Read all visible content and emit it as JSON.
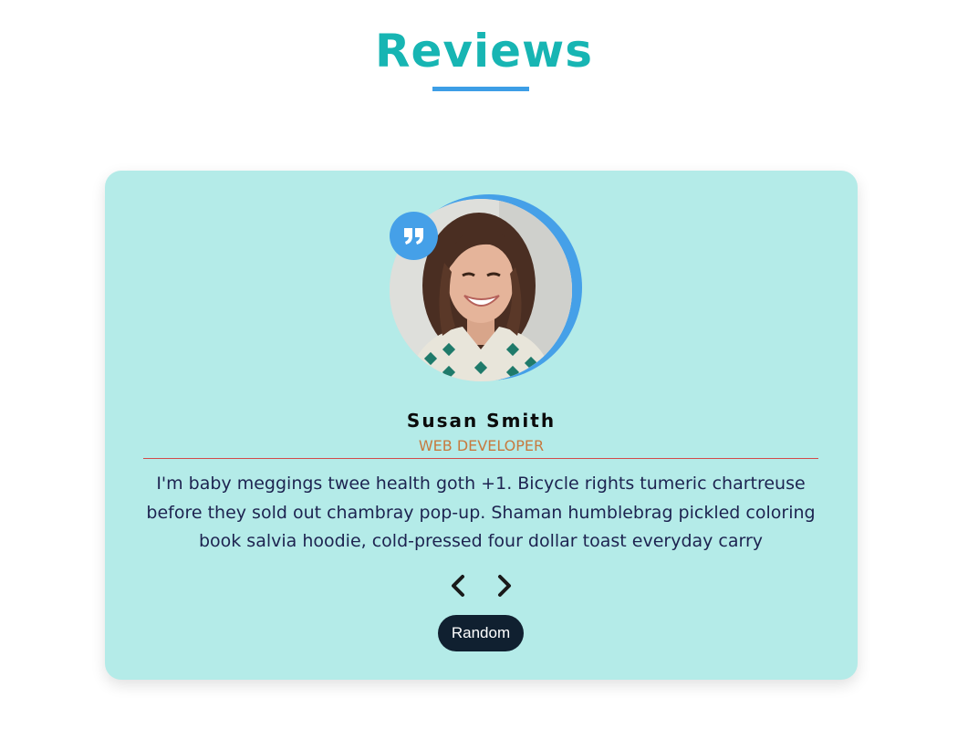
{
  "header": {
    "title": "Reviews"
  },
  "review": {
    "name": "Susan Smith",
    "job": "web developer",
    "text": "I'm baby meggings twee health goth +1. Bicycle rights tumeric chartreuse before they sold out chambray pop-up. Shaman humblebrag pickled coloring book salvia hoodie, cold-pressed four dollar toast everyday carry",
    "avatar_icon": "person-photo-icon",
    "quote_icon": "quote-icon"
  },
  "controls": {
    "prev_icon": "chevron-left-icon",
    "next_icon": "chevron-right-icon",
    "random_label": "Random"
  },
  "colors": {
    "title": "#17b5b3",
    "accent": "#45a0e8",
    "card_bg": "#b4ebe8",
    "job": "#c77a3f",
    "divider": "#d24b4b",
    "text": "#1d2350",
    "button_bg": "#102030"
  }
}
